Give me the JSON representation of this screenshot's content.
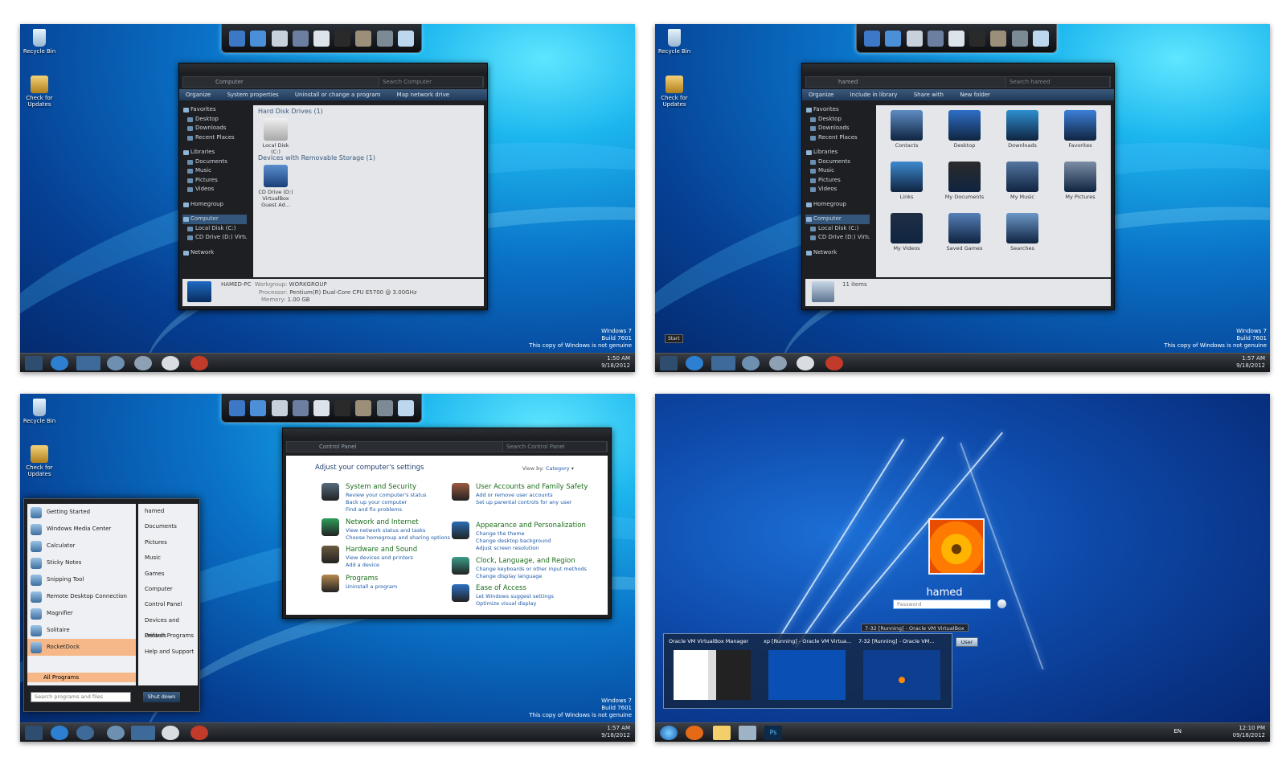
{
  "common": {
    "desktop_icons": [
      "Recycle Bin",
      "Check for Updates"
    ],
    "watermark": [
      "Windows 7",
      "Build 7601",
      "This copy of Windows is not genuine"
    ],
    "tray_dates": {
      "p1": [
        "1:50 AM",
        "9/18/2012"
      ],
      "p2": [
        "1:57 AM",
        "9/18/2012"
      ],
      "p3": [
        "1:57 AM",
        "9/18/2012"
      ],
      "p4": [
        "12:10 PM",
        "09/18/2012"
      ]
    }
  },
  "explorer_computer": {
    "address": "Computer",
    "search_placeholder": "Search Computer",
    "toolbar": [
      "Organize",
      "System properties",
      "Uninstall or change a program",
      "Map network drive"
    ],
    "nav": [
      {
        "label": "Favorites",
        "grp": true
      },
      {
        "label": "Desktop"
      },
      {
        "label": "Downloads"
      },
      {
        "label": "Recent Places"
      },
      {
        "label": "",
        "gap": true
      },
      {
        "label": "Libraries",
        "grp": true
      },
      {
        "label": "Documents"
      },
      {
        "label": "Music"
      },
      {
        "label": "Pictures"
      },
      {
        "label": "Videos"
      },
      {
        "label": "",
        "gap": true
      },
      {
        "label": "Homegroup",
        "grp": true
      },
      {
        "label": "",
        "gap": true
      },
      {
        "label": "Computer",
        "grp": true,
        "sel": true
      },
      {
        "label": "Local Disk (C:)"
      },
      {
        "label": "CD Drive (D:) Virtu"
      },
      {
        "label": "",
        "gap": true
      },
      {
        "label": "Network",
        "grp": true
      }
    ],
    "group1": "Hard Disk Drives (1)",
    "drive1": "Local Disk (C:)",
    "group2": "Devices with Removable Storage (1)",
    "drive2": "CD Drive (D:) VirtualBox Guest Ad...",
    "details": {
      "pc": "HAMED-PC",
      "workgroup_label": "Workgroup:",
      "workgroup": "WORKGROUP",
      "processor_label": "Processor:",
      "processor": "Pentium(R) Dual-Core CPU     E5700 @ 3.00GHz",
      "memory_label": "Memory:",
      "memory": "1.00 GB"
    }
  },
  "explorer_user": {
    "address": "hamed",
    "search_placeholder": "Search hamed",
    "toolbar": [
      "Organize",
      "Include in library",
      "Share with",
      "New folder"
    ],
    "items": [
      "Contacts",
      "Desktop",
      "Downloads",
      "Favorites",
      "Links",
      "My Documents",
      "My Music",
      "My Pictures",
      "My Videos",
      "Saved Games",
      "Searches"
    ],
    "count": "11 items",
    "start_tip": "Start"
  },
  "control_panel": {
    "address": "Control Panel",
    "search_placeholder": "Search Control Panel",
    "heading": "Adjust your computer's settings",
    "view_by_label": "View by:",
    "view_by": "Category",
    "left": [
      {
        "title": "System and Security",
        "links": [
          "Review your computer's status",
          "Back up your computer",
          "Find and fix problems"
        ]
      },
      {
        "title": "Network and Internet",
        "links": [
          "View network status and tasks",
          "Choose homegroup and sharing options"
        ]
      },
      {
        "title": "Hardware and Sound",
        "links": [
          "View devices and printers",
          "Add a device"
        ]
      },
      {
        "title": "Programs",
        "links": [
          "Uninstall a program"
        ]
      }
    ],
    "right": [
      {
        "title": "User Accounts and Family Safety",
        "links": [
          "Add or remove user accounts",
          "Set up parental controls for any user"
        ]
      },
      {
        "title": "Appearance and Personalization",
        "links": [
          "Change the theme",
          "Change desktop background",
          "Adjust screen resolution"
        ]
      },
      {
        "title": "Clock, Language, and Region",
        "links": [
          "Change keyboards or other input methods",
          "Change display language"
        ]
      },
      {
        "title": "Ease of Access",
        "links": [
          "Let Windows suggest settings",
          "Optimize visual display"
        ]
      }
    ]
  },
  "start_menu": {
    "left": [
      "Getting Started",
      "Windows Media Center",
      "Calculator",
      "Sticky Notes",
      "Snipping Tool",
      "Remote Desktop Connection",
      "Magnifier",
      "Solitaire",
      "RocketDock"
    ],
    "all_programs": "All Programs",
    "right": [
      "hamed",
      "Documents",
      "Pictures",
      "Music",
      "Games",
      "Computer",
      "Control Panel",
      "Devices and Printers",
      "Default Programs",
      "Help and Support"
    ],
    "search_placeholder": "Search programs and files",
    "shutdown": "Shut down"
  },
  "login": {
    "username": "hamed",
    "password_placeholder": "Password",
    "tooltip": "7-32 [Running] - Oracle VM VirtualBox",
    "thumbnails": [
      "Oracle VM VirtualBox Manager",
      "xp [Running] - Oracle VM Virtua...",
      "7-32 [Running] - Oracle VM..."
    ],
    "user_button": "User",
    "lang": "EN",
    "ps": "Ps"
  }
}
